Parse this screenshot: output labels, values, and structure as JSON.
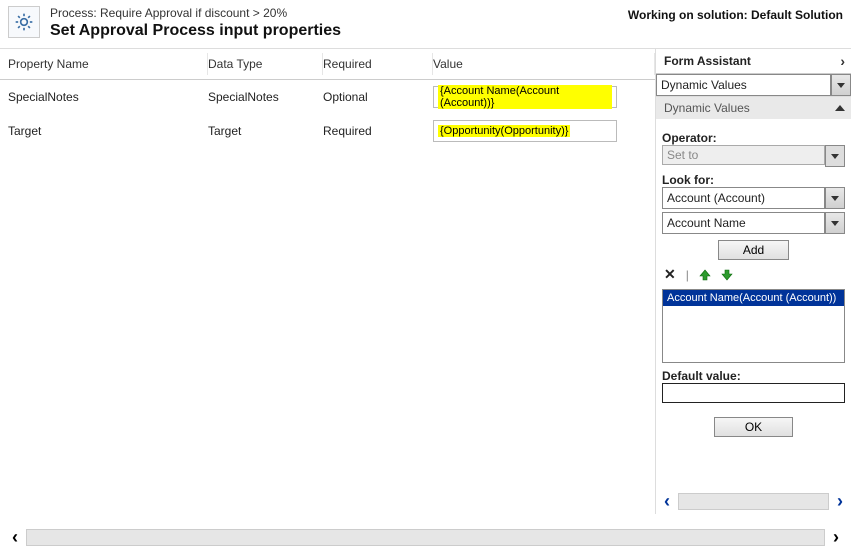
{
  "header": {
    "process_prefix": "Process: ",
    "process_name": "Require Approval if discount > 20%",
    "title": "Set Approval Process input properties",
    "working_on_prefix": "Working on solution: ",
    "solution_name": "Default Solution"
  },
  "grid": {
    "columns": {
      "name": "Property Name",
      "type": "Data Type",
      "required": "Required",
      "value": "Value"
    },
    "rows": [
      {
        "name": "SpecialNotes",
        "type": "SpecialNotes",
        "required": "Optional",
        "value_token": "{Account Name(Account (Account))}"
      },
      {
        "name": "Target",
        "type": "Target",
        "required": "Required",
        "value_token": "{Opportunity(Opportunity)}"
      }
    ]
  },
  "assistant": {
    "title": "Form Assistant",
    "top_select": "Dynamic Values",
    "section_label": "Dynamic Values",
    "operator_label": "Operator:",
    "operator_value": "Set to",
    "lookfor_label": "Look for:",
    "lookfor_entity": "Account (Account)",
    "lookfor_attr": "Account Name",
    "add_button": "Add",
    "selected_item": "Account Name(Account (Account))",
    "default_label": "Default value:",
    "default_value": "",
    "ok_button": "OK"
  }
}
